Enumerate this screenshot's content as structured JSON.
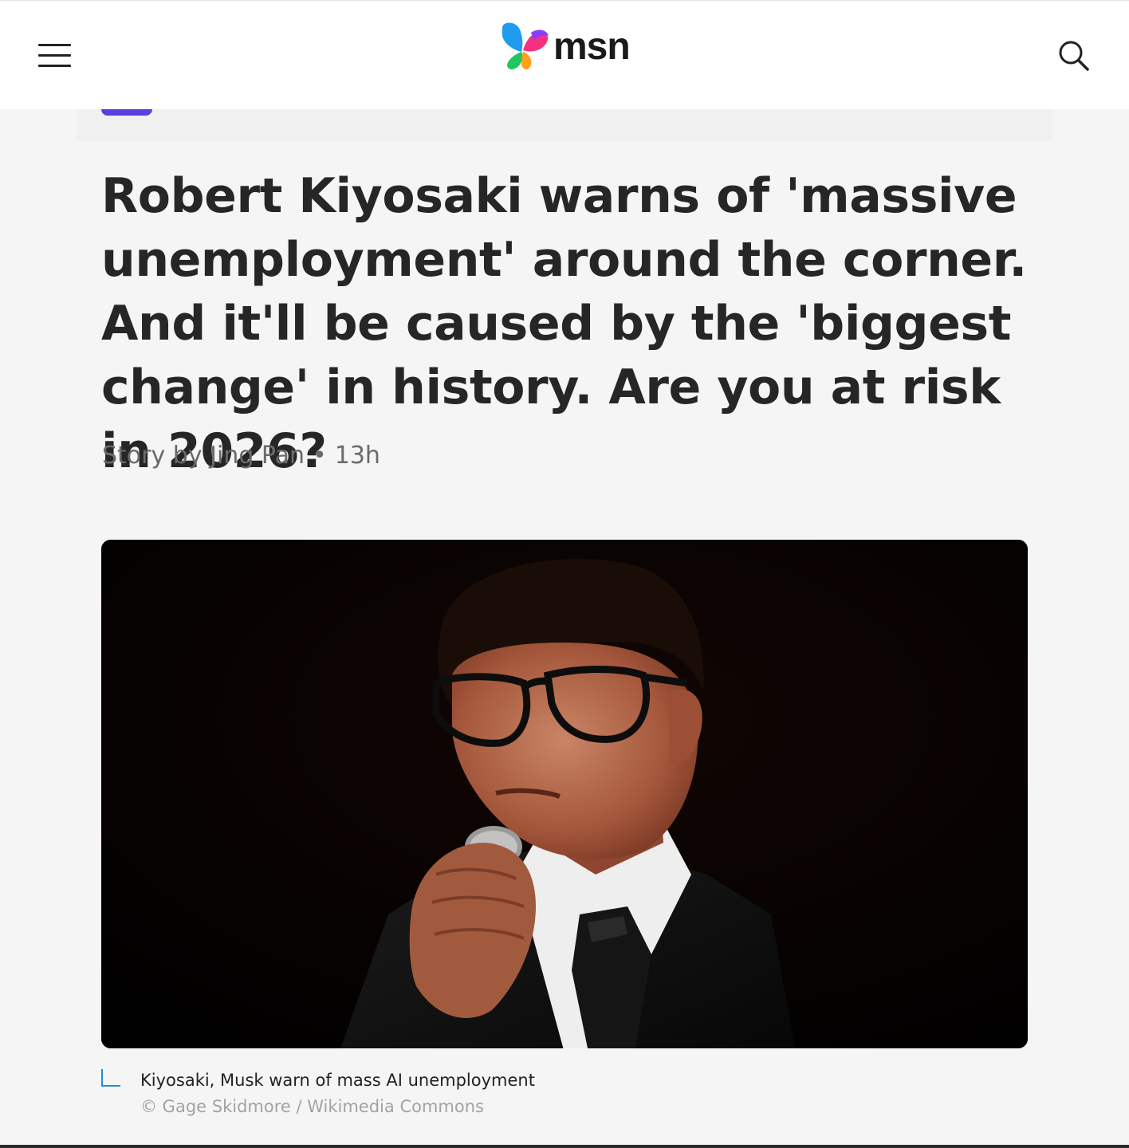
{
  "header": {
    "brand": "msn",
    "menu_icon": "hamburger-menu-icon",
    "search_icon": "search-icon",
    "brand_colors": [
      "#1f9bf0",
      "#8b3cf7",
      "#f5317f",
      "#ff9f1a",
      "#22c55e"
    ]
  },
  "article": {
    "headline": "Robert Kiyosaki warns of 'massive unemployment' around the corner. And it'll be caused by the 'biggest change' in history. Are you at risk in 2026?",
    "byline_author": "Story by Jing Pan",
    "byline_separator": "•",
    "byline_time": "13h"
  },
  "hero_image": {
    "caption": "Kiyosaki, Musk warn of mass AI unemployment",
    "credit": "© Gage Skidmore / Wikimedia Commons"
  },
  "colors": {
    "accent_purple": "#5a3fe0",
    "caption_marker": "#1f8fd0",
    "page_background": "#f5f5f5"
  }
}
